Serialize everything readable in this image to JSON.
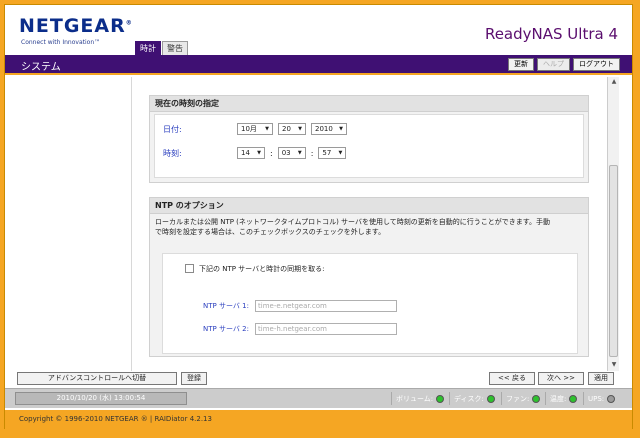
{
  "header": {
    "logo": "NETGEAR",
    "logo_mark": "®",
    "logo_sub": "Connect with Innovation™",
    "product": "ReadyNAS Ultra 4",
    "tabs": [
      {
        "label": "時計"
      },
      {
        "label": "警告"
      }
    ]
  },
  "navbar": {
    "title": "システム",
    "buttons": {
      "refresh": "更新",
      "help": "ヘルプ",
      "logout": "ログアウト"
    }
  },
  "time_panel": {
    "title": "現在の時刻の指定",
    "date_label": "日付:",
    "month": "10月",
    "day": "20",
    "year": "2010",
    "time_label": "時刻:",
    "hour": "14",
    "minute": "03",
    "second": "57",
    "sep": ":"
  },
  "ntp_panel": {
    "title": "NTP のオプション",
    "desc_line1": "ローカルまたは公開 NTP (ネットワークタイムプロトコル) サーバを使用して時刻の更新を自動的に行うことができます。手動",
    "desc_line2": "で時刻を設定する場合は、このチェックボックスのチェックを外します。",
    "sync_label": "下記の NTP サーバと時計の同期を取る:",
    "server1_label": "NTP サーバ 1:",
    "server1_value": "time-e.netgear.com",
    "server2_label": "NTP サーバ 2:",
    "server2_value": "time-h.netgear.com"
  },
  "bottom": {
    "advanced": "アドバンスコントロールへ切替",
    "register": "登録",
    "back": "<< 戻る",
    "next": "次へ >>",
    "apply": "適用"
  },
  "status": {
    "datetime": "2010/10/20 (水) 13:00:54",
    "indicators": [
      {
        "label": "ボリューム:",
        "state": "green"
      },
      {
        "label": "ディスク:",
        "state": "green"
      },
      {
        "label": "ファン:",
        "state": "green"
      },
      {
        "label": "温度:",
        "state": "green"
      },
      {
        "label": "UPS:",
        "state": "grey"
      }
    ]
  },
  "footer": {
    "text": "Copyright © 1996-2010 NETGEAR ® | RAIDiator 4.2.13"
  },
  "colors": {
    "nav": "#3f1073",
    "accent": "#f5a623",
    "label_blue": "#2b3fbf"
  }
}
